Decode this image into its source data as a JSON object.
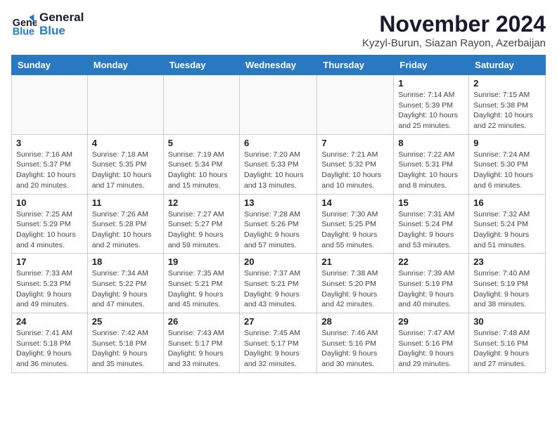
{
  "header": {
    "logo_line1": "General",
    "logo_line2": "Blue",
    "month_title": "November 2024",
    "location": "Kyzyl-Burun, Siazan Rayon, Azerbaijan"
  },
  "weekdays": [
    "Sunday",
    "Monday",
    "Tuesday",
    "Wednesday",
    "Thursday",
    "Friday",
    "Saturday"
  ],
  "weeks": [
    [
      {
        "day": "",
        "detail": ""
      },
      {
        "day": "",
        "detail": ""
      },
      {
        "day": "",
        "detail": ""
      },
      {
        "day": "",
        "detail": ""
      },
      {
        "day": "",
        "detail": ""
      },
      {
        "day": "1",
        "detail": "Sunrise: 7:14 AM\nSunset: 5:39 PM\nDaylight: 10 hours and 25 minutes."
      },
      {
        "day": "2",
        "detail": "Sunrise: 7:15 AM\nSunset: 5:38 PM\nDaylight: 10 hours and 22 minutes."
      }
    ],
    [
      {
        "day": "3",
        "detail": "Sunrise: 7:16 AM\nSunset: 5:37 PM\nDaylight: 10 hours and 20 minutes."
      },
      {
        "day": "4",
        "detail": "Sunrise: 7:18 AM\nSunset: 5:35 PM\nDaylight: 10 hours and 17 minutes."
      },
      {
        "day": "5",
        "detail": "Sunrise: 7:19 AM\nSunset: 5:34 PM\nDaylight: 10 hours and 15 minutes."
      },
      {
        "day": "6",
        "detail": "Sunrise: 7:20 AM\nSunset: 5:33 PM\nDaylight: 10 hours and 13 minutes."
      },
      {
        "day": "7",
        "detail": "Sunrise: 7:21 AM\nSunset: 5:32 PM\nDaylight: 10 hours and 10 minutes."
      },
      {
        "day": "8",
        "detail": "Sunrise: 7:22 AM\nSunset: 5:31 PM\nDaylight: 10 hours and 8 minutes."
      },
      {
        "day": "9",
        "detail": "Sunrise: 7:24 AM\nSunset: 5:30 PM\nDaylight: 10 hours and 6 minutes."
      }
    ],
    [
      {
        "day": "10",
        "detail": "Sunrise: 7:25 AM\nSunset: 5:29 PM\nDaylight: 10 hours and 4 minutes."
      },
      {
        "day": "11",
        "detail": "Sunrise: 7:26 AM\nSunset: 5:28 PM\nDaylight: 10 hours and 2 minutes."
      },
      {
        "day": "12",
        "detail": "Sunrise: 7:27 AM\nSunset: 5:27 PM\nDaylight: 9 hours and 59 minutes."
      },
      {
        "day": "13",
        "detail": "Sunrise: 7:28 AM\nSunset: 5:26 PM\nDaylight: 9 hours and 57 minutes."
      },
      {
        "day": "14",
        "detail": "Sunrise: 7:30 AM\nSunset: 5:25 PM\nDaylight: 9 hours and 55 minutes."
      },
      {
        "day": "15",
        "detail": "Sunrise: 7:31 AM\nSunset: 5:24 PM\nDaylight: 9 hours and 53 minutes."
      },
      {
        "day": "16",
        "detail": "Sunrise: 7:32 AM\nSunset: 5:24 PM\nDaylight: 9 hours and 51 minutes."
      }
    ],
    [
      {
        "day": "17",
        "detail": "Sunrise: 7:33 AM\nSunset: 5:23 PM\nDaylight: 9 hours and 49 minutes."
      },
      {
        "day": "18",
        "detail": "Sunrise: 7:34 AM\nSunset: 5:22 PM\nDaylight: 9 hours and 47 minutes."
      },
      {
        "day": "19",
        "detail": "Sunrise: 7:35 AM\nSunset: 5:21 PM\nDaylight: 9 hours and 45 minutes."
      },
      {
        "day": "20",
        "detail": "Sunrise: 7:37 AM\nSunset: 5:21 PM\nDaylight: 9 hours and 43 minutes."
      },
      {
        "day": "21",
        "detail": "Sunrise: 7:38 AM\nSunset: 5:20 PM\nDaylight: 9 hours and 42 minutes."
      },
      {
        "day": "22",
        "detail": "Sunrise: 7:39 AM\nSunset: 5:19 PM\nDaylight: 9 hours and 40 minutes."
      },
      {
        "day": "23",
        "detail": "Sunrise: 7:40 AM\nSunset: 5:19 PM\nDaylight: 9 hours and 38 minutes."
      }
    ],
    [
      {
        "day": "24",
        "detail": "Sunrise: 7:41 AM\nSunset: 5:18 PM\nDaylight: 9 hours and 36 minutes."
      },
      {
        "day": "25",
        "detail": "Sunrise: 7:42 AM\nSunset: 5:18 PM\nDaylight: 9 hours and 35 minutes."
      },
      {
        "day": "26",
        "detail": "Sunrise: 7:43 AM\nSunset: 5:17 PM\nDaylight: 9 hours and 33 minutes."
      },
      {
        "day": "27",
        "detail": "Sunrise: 7:45 AM\nSunset: 5:17 PM\nDaylight: 9 hours and 32 minutes."
      },
      {
        "day": "28",
        "detail": "Sunrise: 7:46 AM\nSunset: 5:16 PM\nDaylight: 9 hours and 30 minutes."
      },
      {
        "day": "29",
        "detail": "Sunrise: 7:47 AM\nSunset: 5:16 PM\nDaylight: 9 hours and 29 minutes."
      },
      {
        "day": "30",
        "detail": "Sunrise: 7:48 AM\nSunset: 5:16 PM\nDaylight: 9 hours and 27 minutes."
      }
    ]
  ]
}
